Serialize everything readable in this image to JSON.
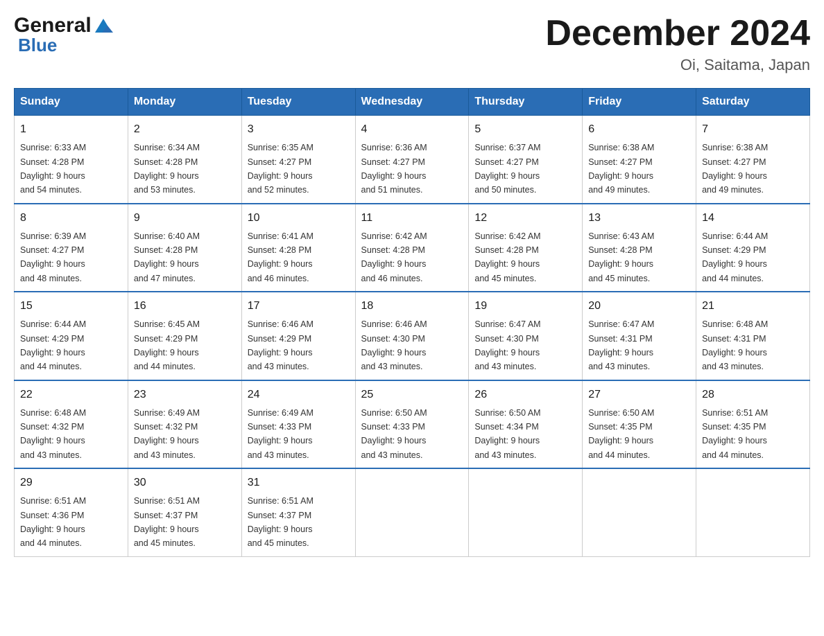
{
  "logo": {
    "general": "General",
    "blue": "Blue"
  },
  "title": {
    "month_year": "December 2024",
    "location": "Oi, Saitama, Japan"
  },
  "weekdays": [
    "Sunday",
    "Monday",
    "Tuesday",
    "Wednesday",
    "Thursday",
    "Friday",
    "Saturday"
  ],
  "weeks": [
    [
      {
        "day": "1",
        "sunrise": "6:33 AM",
        "sunset": "4:28 PM",
        "daylight": "9 hours and 54 minutes."
      },
      {
        "day": "2",
        "sunrise": "6:34 AM",
        "sunset": "4:28 PM",
        "daylight": "9 hours and 53 minutes."
      },
      {
        "day": "3",
        "sunrise": "6:35 AM",
        "sunset": "4:27 PM",
        "daylight": "9 hours and 52 minutes."
      },
      {
        "day": "4",
        "sunrise": "6:36 AM",
        "sunset": "4:27 PM",
        "daylight": "9 hours and 51 minutes."
      },
      {
        "day": "5",
        "sunrise": "6:37 AM",
        "sunset": "4:27 PM",
        "daylight": "9 hours and 50 minutes."
      },
      {
        "day": "6",
        "sunrise": "6:38 AM",
        "sunset": "4:27 PM",
        "daylight": "9 hours and 49 minutes."
      },
      {
        "day": "7",
        "sunrise": "6:38 AM",
        "sunset": "4:27 PM",
        "daylight": "9 hours and 49 minutes."
      }
    ],
    [
      {
        "day": "8",
        "sunrise": "6:39 AM",
        "sunset": "4:27 PM",
        "daylight": "9 hours and 48 minutes."
      },
      {
        "day": "9",
        "sunrise": "6:40 AM",
        "sunset": "4:28 PM",
        "daylight": "9 hours and 47 minutes."
      },
      {
        "day": "10",
        "sunrise": "6:41 AM",
        "sunset": "4:28 PM",
        "daylight": "9 hours and 46 minutes."
      },
      {
        "day": "11",
        "sunrise": "6:42 AM",
        "sunset": "4:28 PM",
        "daylight": "9 hours and 46 minutes."
      },
      {
        "day": "12",
        "sunrise": "6:42 AM",
        "sunset": "4:28 PM",
        "daylight": "9 hours and 45 minutes."
      },
      {
        "day": "13",
        "sunrise": "6:43 AM",
        "sunset": "4:28 PM",
        "daylight": "9 hours and 45 minutes."
      },
      {
        "day": "14",
        "sunrise": "6:44 AM",
        "sunset": "4:29 PM",
        "daylight": "9 hours and 44 minutes."
      }
    ],
    [
      {
        "day": "15",
        "sunrise": "6:44 AM",
        "sunset": "4:29 PM",
        "daylight": "9 hours and 44 minutes."
      },
      {
        "day": "16",
        "sunrise": "6:45 AM",
        "sunset": "4:29 PM",
        "daylight": "9 hours and 44 minutes."
      },
      {
        "day": "17",
        "sunrise": "6:46 AM",
        "sunset": "4:29 PM",
        "daylight": "9 hours and 43 minutes."
      },
      {
        "day": "18",
        "sunrise": "6:46 AM",
        "sunset": "4:30 PM",
        "daylight": "9 hours and 43 minutes."
      },
      {
        "day": "19",
        "sunrise": "6:47 AM",
        "sunset": "4:30 PM",
        "daylight": "9 hours and 43 minutes."
      },
      {
        "day": "20",
        "sunrise": "6:47 AM",
        "sunset": "4:31 PM",
        "daylight": "9 hours and 43 minutes."
      },
      {
        "day": "21",
        "sunrise": "6:48 AM",
        "sunset": "4:31 PM",
        "daylight": "9 hours and 43 minutes."
      }
    ],
    [
      {
        "day": "22",
        "sunrise": "6:48 AM",
        "sunset": "4:32 PM",
        "daylight": "9 hours and 43 minutes."
      },
      {
        "day": "23",
        "sunrise": "6:49 AM",
        "sunset": "4:32 PM",
        "daylight": "9 hours and 43 minutes."
      },
      {
        "day": "24",
        "sunrise": "6:49 AM",
        "sunset": "4:33 PM",
        "daylight": "9 hours and 43 minutes."
      },
      {
        "day": "25",
        "sunrise": "6:50 AM",
        "sunset": "4:33 PM",
        "daylight": "9 hours and 43 minutes."
      },
      {
        "day": "26",
        "sunrise": "6:50 AM",
        "sunset": "4:34 PM",
        "daylight": "9 hours and 43 minutes."
      },
      {
        "day": "27",
        "sunrise": "6:50 AM",
        "sunset": "4:35 PM",
        "daylight": "9 hours and 44 minutes."
      },
      {
        "day": "28",
        "sunrise": "6:51 AM",
        "sunset": "4:35 PM",
        "daylight": "9 hours and 44 minutes."
      }
    ],
    [
      {
        "day": "29",
        "sunrise": "6:51 AM",
        "sunset": "4:36 PM",
        "daylight": "9 hours and 44 minutes."
      },
      {
        "day": "30",
        "sunrise": "6:51 AM",
        "sunset": "4:37 PM",
        "daylight": "9 hours and 45 minutes."
      },
      {
        "day": "31",
        "sunrise": "6:51 AM",
        "sunset": "4:37 PM",
        "daylight": "9 hours and 45 minutes."
      },
      null,
      null,
      null,
      null
    ]
  ]
}
